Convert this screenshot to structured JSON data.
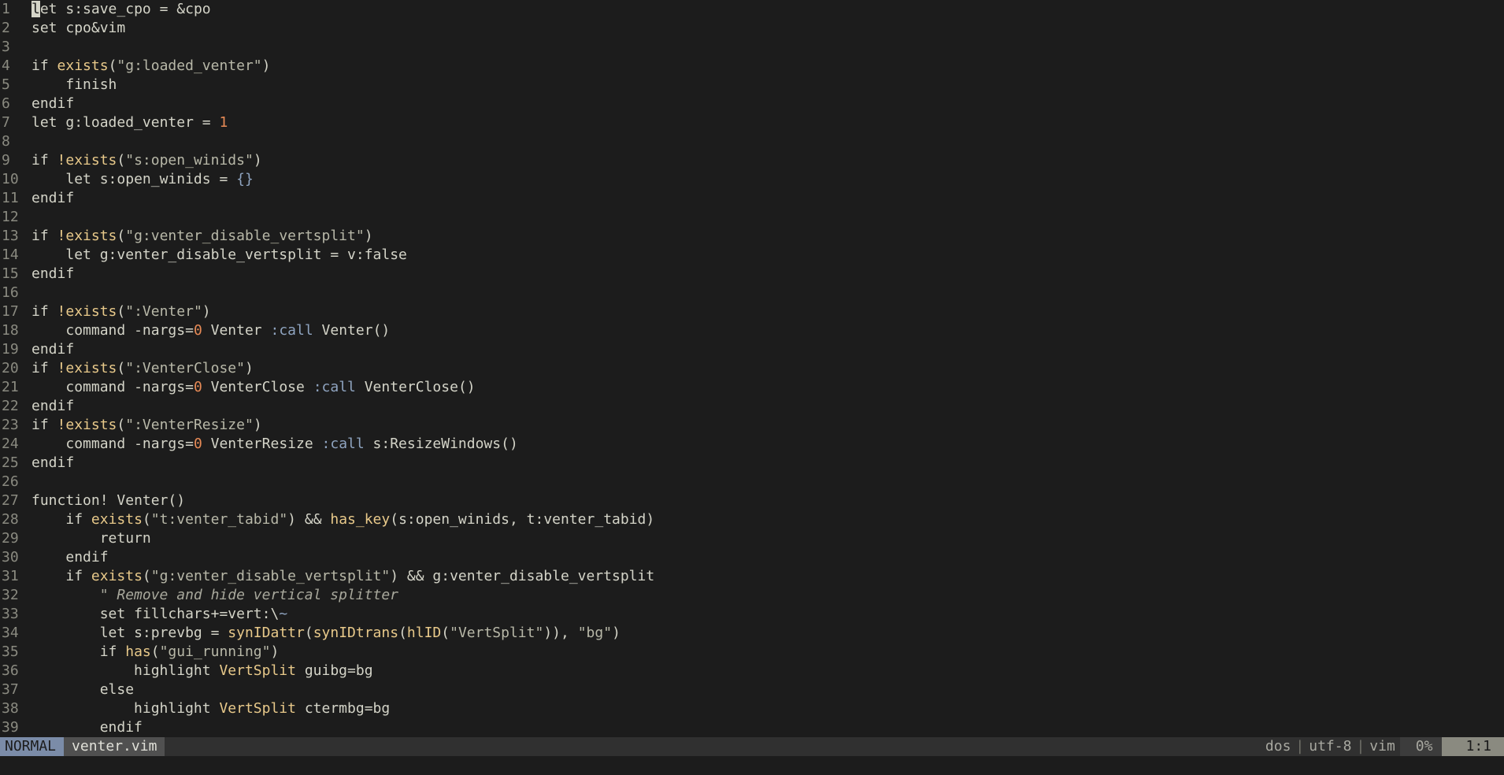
{
  "editor": {
    "lines": [
      {
        "n": "1",
        "code": "let s:save_cpo = &cpo"
      },
      {
        "n": "2",
        "code": "set cpo&vim"
      },
      {
        "n": "3",
        "code": ""
      },
      {
        "n": "4",
        "code": "if exists(\"g:loaded_venter\")"
      },
      {
        "n": "5",
        "code": "    finish"
      },
      {
        "n": "6",
        "code": "endif"
      },
      {
        "n": "7",
        "code": "let g:loaded_venter = 1"
      },
      {
        "n": "8",
        "code": ""
      },
      {
        "n": "9",
        "code": "if !exists(\"s:open_winids\")"
      },
      {
        "n": "10",
        "code": "    let s:open_winids = {}"
      },
      {
        "n": "11",
        "code": "endif"
      },
      {
        "n": "12",
        "code": ""
      },
      {
        "n": "13",
        "code": "if !exists(\"g:venter_disable_vertsplit\")"
      },
      {
        "n": "14",
        "code": "    let g:venter_disable_vertsplit = v:false"
      },
      {
        "n": "15",
        "code": "endif"
      },
      {
        "n": "16",
        "code": ""
      },
      {
        "n": "17",
        "code": "if !exists(\":Venter\")"
      },
      {
        "n": "18",
        "code": "    command -nargs=0 Venter :call Venter()"
      },
      {
        "n": "19",
        "code": "endif"
      },
      {
        "n": "20",
        "code": "if !exists(\":VenterClose\")"
      },
      {
        "n": "21",
        "code": "    command -nargs=0 VenterClose :call VenterClose()"
      },
      {
        "n": "22",
        "code": "endif"
      },
      {
        "n": "23",
        "code": "if !exists(\":VenterResize\")"
      },
      {
        "n": "24",
        "code": "    command -nargs=0 VenterResize :call s:ResizeWindows()"
      },
      {
        "n": "25",
        "code": "endif"
      },
      {
        "n": "26",
        "code": ""
      },
      {
        "n": "27",
        "code": "function! Venter()"
      },
      {
        "n": "28",
        "code": "    if exists(\"t:venter_tabid\") && has_key(s:open_winids, t:venter_tabid)"
      },
      {
        "n": "29",
        "code": "        return"
      },
      {
        "n": "30",
        "code": "    endif"
      },
      {
        "n": "31",
        "code": "    if exists(\"g:venter_disable_vertsplit\") && g:venter_disable_vertsplit"
      },
      {
        "n": "32",
        "code": "        \" Remove and hide vertical splitter"
      },
      {
        "n": "33",
        "code": "        set fillchars+=vert:\\~"
      },
      {
        "n": "34",
        "code": "        let s:prevbg = synIDattr(synIDtrans(hlID(\"VertSplit\")), \"bg\")"
      },
      {
        "n": "35",
        "code": "        if has(\"gui_running\")"
      },
      {
        "n": "36",
        "code": "            highlight VertSplit guibg=bg"
      },
      {
        "n": "37",
        "code": "        else"
      },
      {
        "n": "38",
        "code": "            highlight VertSplit ctermbg=bg"
      },
      {
        "n": "39",
        "code": "        endif"
      }
    ]
  },
  "statusline": {
    "mode": "NORMAL",
    "filename": "venter.vim",
    "fileformat": "dos",
    "encoding": "utf-8",
    "filetype": "vim",
    "separator": "|",
    "percent": "0%",
    "position": "1:1"
  },
  "colors": {
    "background": "#1c1c1c",
    "mode_bg": "#7b8ca8",
    "keyword_yellow": "#e8c98a",
    "number_orange": "#e68a56"
  }
}
